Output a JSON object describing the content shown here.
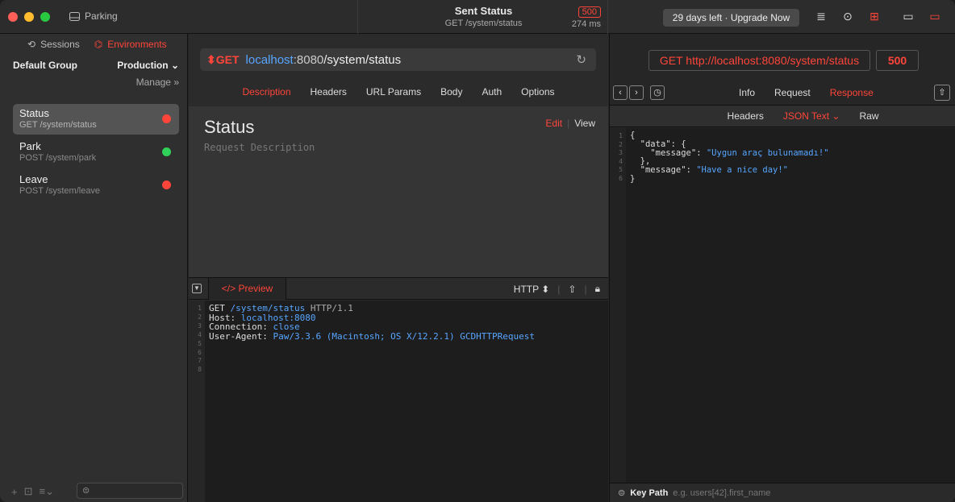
{
  "window": {
    "title": "Parking"
  },
  "titlebar": {
    "sent_status": "Sent Status",
    "sent_path": "GET /system/status",
    "status_code": "500",
    "elapsed": "274 ms",
    "upgrade_label": "29 days left · Upgrade Now"
  },
  "sidebar": {
    "tab_sessions": "Sessions",
    "tab_environments": "Environments",
    "group": "Default Group",
    "environment": "Production",
    "manage": "Manage",
    "requests": [
      {
        "name": "Status",
        "sub": "GET /system/status",
        "status_color": "#ff453a"
      },
      {
        "name": "Park",
        "sub": "POST /system/park",
        "status_color": "#30d158"
      },
      {
        "name": "Leave",
        "sub": "POST /system/leave",
        "status_color": "#ff453a"
      }
    ]
  },
  "request": {
    "method": "GET",
    "host": "localhost",
    "port": ":8080",
    "path": "/system/status",
    "tabs": [
      "Description",
      "Headers",
      "URL Params",
      "Body",
      "Auth",
      "Options"
    ],
    "title": "Status",
    "description_placeholder": "Request Description",
    "edit": "Edit",
    "view": "View",
    "preview_tab": "Preview",
    "format": "HTTP"
  },
  "raw_request": {
    "line1_method": "GET",
    "line1_path": "/system/status",
    "line1_proto": "HTTP/1.1",
    "host_key": "Host:",
    "host_val": "localhost:8080",
    "conn_key": "Connection:",
    "conn_val": "close",
    "ua_key": "User-Agent:",
    "ua_val": "Paw/3.3.6 (Macintosh; OS X/12.2.1) GCDHTTPRequest"
  },
  "response": {
    "url": "GET http://localhost:8080/system/status",
    "code": "500",
    "tabs": [
      "Info",
      "Request",
      "Response"
    ],
    "subtabs": [
      "Headers",
      "JSON Text",
      "Raw"
    ],
    "json": {
      "data_key": "\"data\"",
      "message_key": "\"message\"",
      "message_val": "\"Uygun araç bulunamadı!\"",
      "message2_key": "\"message\"",
      "message2_val": "\"Have a nice day!\""
    },
    "keypath_label": "Key Path",
    "keypath_placeholder": "e.g. users[42].first_name"
  }
}
